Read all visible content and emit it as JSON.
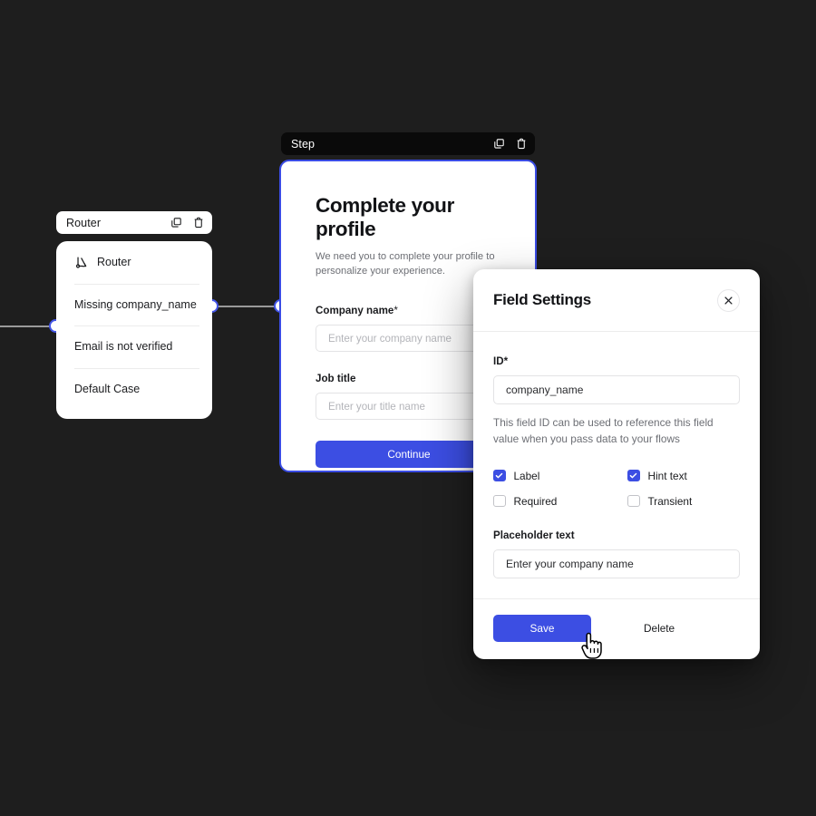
{
  "theme": {
    "canvas_bg": "#1e1e1e",
    "accent_blue": "#3c4ee3",
    "handle_border": "#4355e8",
    "edge_color": "#9a9a9a"
  },
  "router_node": {
    "header": {
      "title": "Router",
      "duplicate_icon": "duplicate-icon",
      "delete_icon": "trash-icon"
    },
    "rows": [
      {
        "label": "Router",
        "icon": "router-branch-icon"
      },
      {
        "label": "Missing company_name",
        "icon": ""
      },
      {
        "label": "Email is not verified",
        "icon": ""
      },
      {
        "label": "Default Case",
        "icon": ""
      }
    ]
  },
  "step_node": {
    "header": {
      "title": "Step",
      "duplicate_icon": "duplicate-icon",
      "delete_icon": "trash-icon"
    },
    "form": {
      "title": "Complete your profile",
      "subtitle": "We need you to complete your profile to personalize your experience.",
      "fields": [
        {
          "label": "Company name",
          "required_mark": "*",
          "placeholder": "Enter your company name"
        },
        {
          "label": "Job title",
          "required_mark": "",
          "placeholder": "Enter your title name"
        }
      ],
      "submit_label": "Continue"
    }
  },
  "field_settings": {
    "title": "Field Settings",
    "close_icon": "close-icon",
    "id_label": "ID",
    "id_required_mark": "*",
    "id_value": "company_name",
    "id_hint": "This field ID can be used to reference this field value when you pass data to your flows",
    "checkboxes": [
      {
        "label": "Label",
        "checked": true
      },
      {
        "label": "Hint text",
        "checked": true
      },
      {
        "label": "Required",
        "checked": false
      },
      {
        "label": "Transient",
        "checked": false
      }
    ],
    "placeholder_label": "Placeholder text",
    "placeholder_value": "Enter your company name",
    "save_label": "Save",
    "delete_label": "Delete"
  },
  "cursor": {
    "type": "pointing-hand-cursor"
  }
}
